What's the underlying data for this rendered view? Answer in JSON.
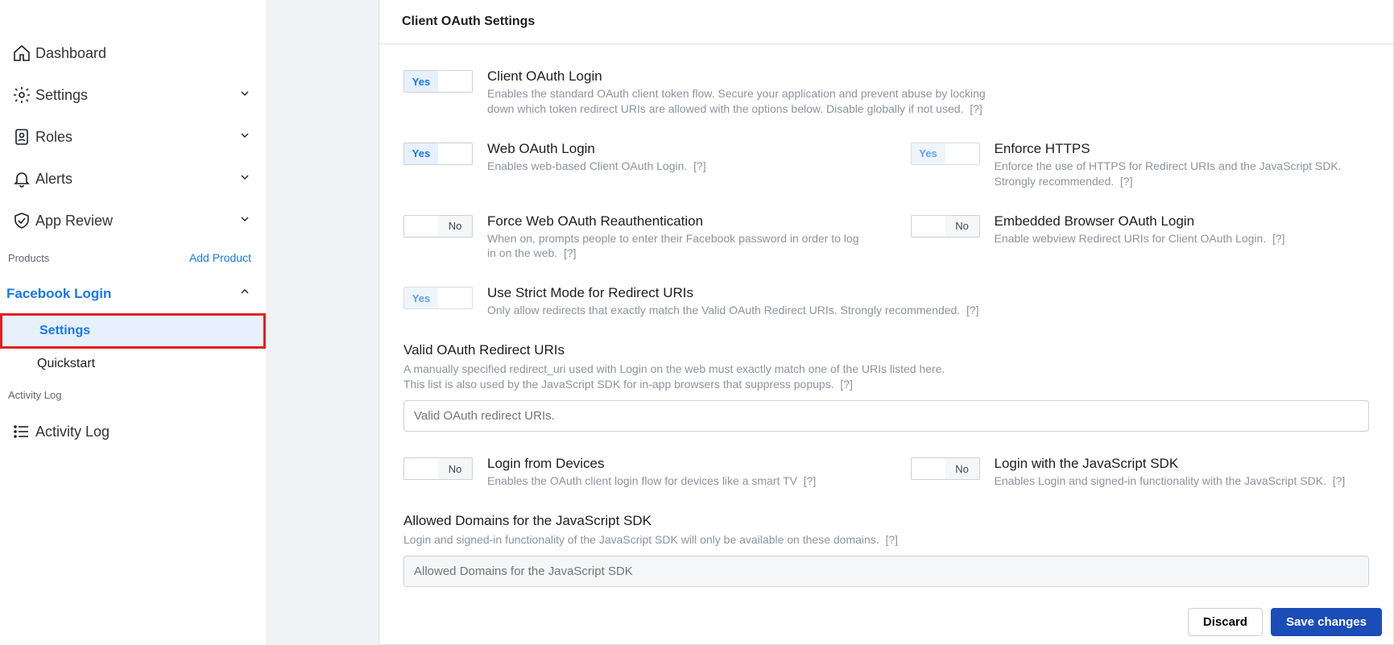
{
  "sidebar": {
    "items": [
      {
        "label": "Dashboard",
        "icon": "home",
        "expandable": false
      },
      {
        "label": "Settings",
        "icon": "gear",
        "expandable": true
      },
      {
        "label": "Roles",
        "icon": "badge",
        "expandable": true
      },
      {
        "label": "Alerts",
        "icon": "bell",
        "expandable": true
      },
      {
        "label": "App Review",
        "icon": "shield-check",
        "expandable": true
      }
    ],
    "products_header": "Products",
    "add_product": "Add Product",
    "product": {
      "name": "Facebook Login",
      "subitems": [
        {
          "label": "Settings",
          "active": true
        },
        {
          "label": "Quickstart",
          "active": false
        }
      ]
    },
    "activity_header": "Activity Log",
    "activity_item": {
      "label": "Activity Log",
      "icon": "list"
    }
  },
  "page_title": "Client OAuth Settings",
  "toggles": {
    "yes": "Yes",
    "no": "No"
  },
  "help_hint": "[?]",
  "settings": {
    "client_oauth": {
      "title": "Client OAuth Login",
      "desc": "Enables the standard OAuth client token flow. Secure your application and prevent abuse by locking down which token redirect URIs are allowed with the options below. Disable globally if not used.",
      "value": "yes"
    },
    "web_oauth": {
      "title": "Web OAuth Login",
      "desc": "Enables web-based Client OAuth Login.",
      "value": "yes"
    },
    "enforce_https": {
      "title": "Enforce HTTPS",
      "desc": "Enforce the use of HTTPS for Redirect URIs and the JavaScript SDK. Strongly recommended.",
      "value": "yes",
      "locked": true
    },
    "force_reauth": {
      "title": "Force Web OAuth Reauthentication",
      "desc": "When on, prompts people to enter their Facebook password in order to log in on the web.",
      "value": "no"
    },
    "embedded": {
      "title": "Embedded Browser OAuth Login",
      "desc": "Enable webview Redirect URIs for Client OAuth Login.",
      "value": "no"
    },
    "strict_mode": {
      "title": "Use Strict Mode for Redirect URIs",
      "desc": "Only allow redirects that exactly match the Valid OAuth Redirect URIs. Strongly recommended.",
      "value": "yes",
      "locked": true
    },
    "login_devices": {
      "title": "Login from Devices",
      "desc": "Enables the OAuth client login flow for devices like a smart TV",
      "value": "no"
    },
    "login_js_sdk": {
      "title": "Login with the JavaScript SDK",
      "desc": "Enables Login and signed-in functionality with the JavaScript SDK.",
      "value": "no"
    }
  },
  "redirect_uris": {
    "title": "Valid OAuth Redirect URIs",
    "desc_line1": "A manually specified redirect_uri used with Login on the web must exactly match one of the URIs listed here.",
    "desc_line2": "This list is also used by the JavaScript SDK for in-app browsers that suppress popups.",
    "placeholder": "Valid OAuth redirect URIs."
  },
  "allowed_domains": {
    "title": "Allowed Domains for the JavaScript SDK",
    "desc": "Login and signed-in functionality of the JavaScript SDK will only be available on these domains.",
    "placeholder": "Allowed Domains for the JavaScript SDK"
  },
  "footer": {
    "discard": "Discard",
    "save": "Save changes"
  }
}
